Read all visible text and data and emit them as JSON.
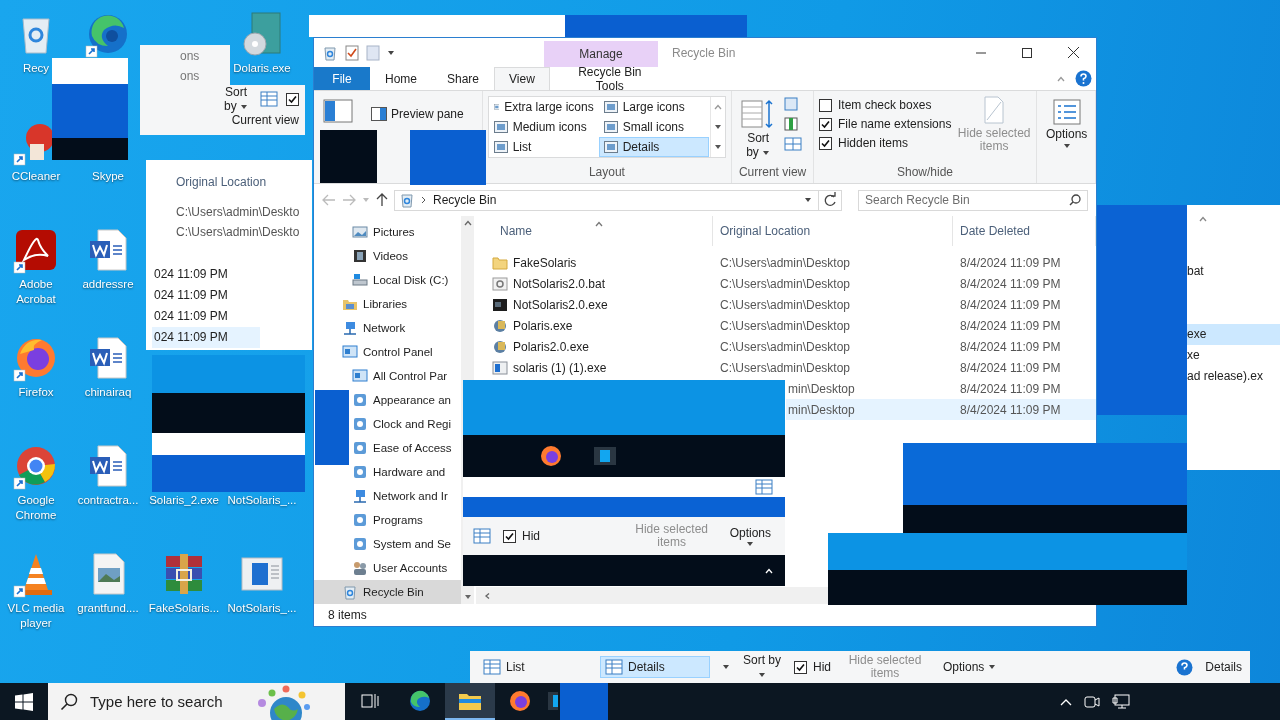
{
  "desktop_icons": [
    {
      "kind": "recycle",
      "label": "Recy",
      "shortcut": false
    },
    {
      "kind": "edge",
      "shortcut": true
    },
    {
      "kind": "installer",
      "label": "Dolaris.exe",
      "shortcut": false
    },
    {
      "kind": "ccleaner",
      "label": "CCleaner",
      "shortcut": true
    },
    {
      "label": "Skype"
    },
    {
      "kind": "pdf",
      "label": "Adobe Acrobat",
      "shortcut": true
    },
    {
      "kind": "word",
      "label": "addressre",
      "shortcut": false
    },
    {
      "kind": "firefox",
      "label": "Firefox",
      "shortcut": true
    },
    {
      "kind": "word",
      "label": "chinairaq",
      "shortcut": false
    },
    {
      "kind": "chrome",
      "label": "Google Chrome",
      "shortcut": true
    },
    {
      "kind": "word",
      "label": "contractra...",
      "shortcut": false
    },
    {
      "label": "Solaris_2.exe"
    },
    {
      "label": "NotSolaris_..."
    },
    {
      "kind": "vlc",
      "label": "VLC media player",
      "shortcut": true
    },
    {
      "kind": "image",
      "label": "grantfund....",
      "shortcut": false
    },
    {
      "kind": "winrar",
      "label": "FakeSolaris...",
      "shortcut": false
    },
    {
      "kind": "app",
      "label": "NotSolaris_...",
      "shortcut": false
    }
  ],
  "explorer": {
    "title": "Recycle Bin",
    "context_header": "Manage",
    "tabs": [
      {
        "label": "File",
        "kind": "file",
        "selected": false
      },
      {
        "label": "Home",
        "kind": "plain",
        "selected": false
      },
      {
        "label": "Share",
        "kind": "plain",
        "selected": false
      },
      {
        "label": "View",
        "kind": "plain",
        "selected": true
      },
      {
        "label": "Recycle Bin Tools",
        "kind": "context",
        "selected": false
      }
    ],
    "ribbon": {
      "preview_pane": "Preview pane",
      "layouts": [
        {
          "label": "Extra large icons",
          "selected": false
        },
        {
          "label": "Large icons",
          "selected": false
        },
        {
          "label": "Medium icons",
          "selected": false
        },
        {
          "label": "Small icons",
          "selected": false
        },
        {
          "label": "List",
          "selected": false
        },
        {
          "label": "Details",
          "selected": true
        }
      ],
      "layout_group": "Layout",
      "sort": "Sort by",
      "current_view_group": "Current view",
      "checks": [
        {
          "label": "Item check boxes",
          "checked": false
        },
        {
          "label": "File name extensions",
          "checked": true
        },
        {
          "label": "Hidden items",
          "checked": true
        }
      ],
      "hide_selected": {
        "label": "Hide selected items",
        "disabled": true
      },
      "show_hide_group": "Show/hide",
      "options": "Options"
    },
    "address": {
      "path": "Recycle Bin",
      "search_placeholder": "Search Recycle Bin"
    },
    "nav_tree": [
      {
        "children": [
          {
            "label": "Pictures",
            "kind": "pictures",
            "selected": false
          },
          {
            "label": "Videos",
            "kind": "videos",
            "selected": false
          },
          {
            "label": "Local Disk (C:)",
            "kind": "disk",
            "selected": false
          }
        ]
      },
      {
        "label": "Libraries",
        "kind": "libraries",
        "selected": false
      },
      {
        "label": "Network",
        "kind": "network",
        "selected": false
      },
      {
        "label": "Control Panel",
        "kind": "control",
        "selected": false,
        "children": [
          {
            "label": "All Control Par",
            "kind": "control",
            "selected": false
          },
          {
            "label": "Appearance an",
            "kind": "setting",
            "selected": false
          },
          {
            "label": "Clock and Regi",
            "kind": "setting",
            "selected": false
          },
          {
            "label": "Ease of Access",
            "kind": "setting",
            "selected": false
          },
          {
            "label": "Hardware and",
            "kind": "setting",
            "selected": false
          },
          {
            "label": "Network and Ir",
            "kind": "network",
            "selected": false
          },
          {
            "label": "Programs",
            "kind": "setting",
            "selected": false
          },
          {
            "label": "System and Se",
            "kind": "setting",
            "selected": false
          },
          {
            "label": "User Accounts",
            "kind": "users",
            "selected": false
          }
        ]
      },
      {
        "label": "Recycle Bin",
        "kind": "recycle",
        "selected": true
      }
    ],
    "columns": [
      "Name",
      "Original Location",
      "Date Deleted"
    ],
    "rows": [
      {
        "kind": "folder",
        "name": "FakeSolaris",
        "location": "C:\\Users\\admin\\Desktop",
        "date": "8/4/2024 11:09 PM",
        "selected": false
      },
      {
        "kind": "bat",
        "name": "NotSolaris2.0.bat",
        "location": "C:\\Users\\admin\\Desktop",
        "date": "8/4/2024 11:09 PM",
        "selected": false
      },
      {
        "kind": "console",
        "name": "NotSolaris2.0.exe",
        "location": "C:\\Users\\admin\\Desktop",
        "date": "8/4/2024 11:09 PM",
        "selected": false
      },
      {
        "kind": "polaris",
        "name": "Polaris.exe",
        "location": "C:\\Users\\admin\\Desktop",
        "date": "8/4/2024 11:09 PM",
        "selected": false
      },
      {
        "kind": "polaris",
        "name": "Polaris2.0.exe",
        "location": "C:\\Users\\admin\\Desktop",
        "date": "8/4/2024 11:09 PM",
        "selected": false
      },
      {
        "kind": "app",
        "name": "solaris (1) (1).exe",
        "location": "C:\\Users\\admin\\Desktop",
        "date": "8/4/2024 11:09 PM",
        "selected": false
      },
      {
        "kind": "clipped",
        "location": "min\\Desktop",
        "date": "8/4/2024 11:09 PM",
        "selected": false
      },
      {
        "kind": "clipped",
        "location": "min\\Desktop",
        "date": "8/4/2024 11:09 PM",
        "selected": true
      }
    ],
    "status": "8 items"
  },
  "fragments": [
    {
      "kind": "ribbon_scroll",
      "texts": [
        "ons",
        "ons"
      ]
    },
    {
      "kind": "ribbon_view",
      "sort": "Sort by",
      "group": "Current view",
      "checked": true
    },
    {
      "kind": "details_list",
      "header": "Original Location",
      "lines": [
        "C:\\Users\\admin\\Deskto",
        "C:\\Users\\admin\\Deskto"
      ],
      "dates": [
        {
          "text": "024 11:09 PM",
          "selected": false
        },
        {
          "text": "024 11:09 PM",
          "selected": false
        },
        {
          "text": "024 11:09 PM",
          "selected": false
        },
        {
          "text": "024 11:09 PM",
          "selected": true
        }
      ]
    },
    {
      "kind": "taskbar_piece",
      "hid": "Hid",
      "checked": true,
      "hide_selected": "Hide selected items",
      "options": "Options"
    },
    {
      "kind": "file_names",
      "items": [
        {
          "text": "bat",
          "selected": false
        },
        {
          "text": "exe",
          "selected": true
        },
        {
          "text": "xe",
          "selected": false
        },
        {
          "text": "ad release).ex",
          "selected": false
        }
      ]
    },
    {
      "kind": "ribbon_strip",
      "list": "List",
      "details": "Details",
      "details_selected": true,
      "sort": "Sort by",
      "hid": "Hid",
      "checked": true,
      "hide_selected": "Hide selected items",
      "options": "Options",
      "details_2": "Details"
    }
  ],
  "taskbar": {
    "search_placeholder": "Type here to search",
    "apps": [
      {
        "kind": "taskview",
        "selected": false
      },
      {
        "kind": "edge",
        "selected": false
      },
      {
        "kind": "explorer",
        "selected": true
      },
      {
        "kind": "firefox",
        "selected": false
      },
      {
        "kind": "terminal",
        "selected": false
      }
    ]
  }
}
